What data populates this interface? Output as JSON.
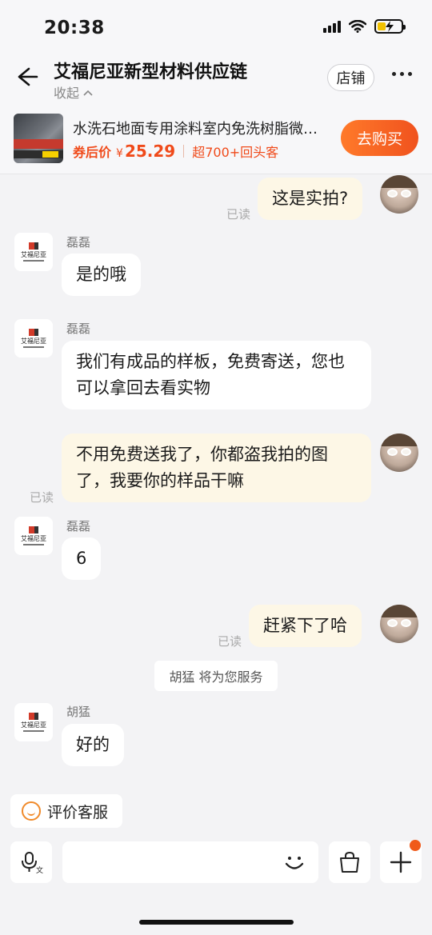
{
  "status_bar": {
    "time": "20:38"
  },
  "header": {
    "title": "艾福尼亚新型材料供应链",
    "collapse_label": "收起",
    "shop_button": "店铺"
  },
  "product": {
    "title": "水洗石地面专用涂料室内免洗树脂微…",
    "coupon_label": "券后价",
    "currency": "¥",
    "price": "25.29",
    "repeat_customers": "超700+回头客",
    "buy_button": "去购买"
  },
  "messages": [
    {
      "side": "out",
      "text": "这是实拍?",
      "read": "已读"
    },
    {
      "side": "in",
      "sender": "磊磊",
      "text": "是的哦"
    },
    {
      "side": "in",
      "sender": "磊磊",
      "text": "我们有成品的样板，免费寄送，您也可以拿回去看实物"
    },
    {
      "side": "out",
      "text": "不用免费送我了，你都盗我拍的图了，我要你的样品干嘛",
      "read": "已读"
    },
    {
      "side": "in",
      "sender": "磊磊",
      "text": "6"
    },
    {
      "side": "out",
      "text": "赶紧下了哈",
      "read": "已读"
    },
    {
      "side": "system",
      "text": "胡猛 将为您服务"
    },
    {
      "side": "in",
      "sender": "胡猛",
      "text": "好的"
    }
  ],
  "shop_avatar_text": "艾福尼亚",
  "footer": {
    "rate_button": "评价客服",
    "input_placeholder": ""
  },
  "colors": {
    "accent": "#f05a1a",
    "out_bubble": "#fdf7e6",
    "background": "#f3f3f5"
  }
}
